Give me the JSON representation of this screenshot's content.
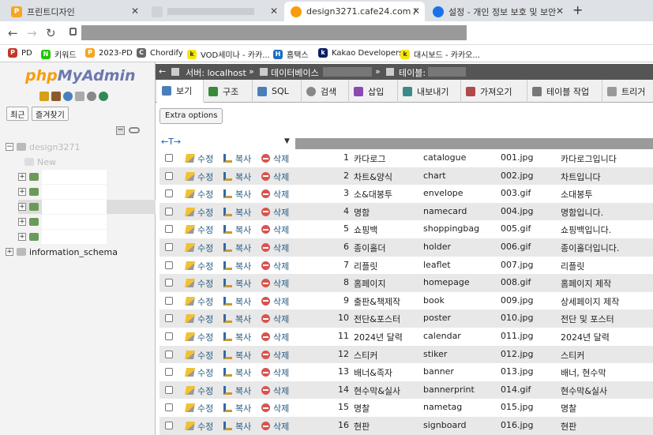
{
  "browser": {
    "tabs": [
      {
        "title": "프린트디자인",
        "icon_color": "#f5a623",
        "icon_letter": "P"
      },
      {
        "title": "",
        "icon_color": "#cfd3d8",
        "icon_letter": ""
      },
      {
        "title": "design3271.cafe24.com / localh",
        "icon_color": "#f89c0e",
        "icon_letter": ""
      },
      {
        "title": "설정 - 개인 정보 보호 및 보안",
        "icon_color": "#1a73e8",
        "icon_letter": ""
      }
    ],
    "new_tab": "+",
    "bookmarks": [
      {
        "label": "PD",
        "color": "#c0392b",
        "letter": "P"
      },
      {
        "label": "키워드",
        "color": "#1ec800",
        "letter": "N"
      },
      {
        "label": "2023-PD",
        "color": "#f5a623",
        "letter": "P"
      },
      {
        "label": "Chordify",
        "color": "#666666",
        "letter": "C"
      },
      {
        "label": "VOD세미나 - 카카...",
        "color": "#f7e600",
        "letter": "k"
      },
      {
        "label": "홈택스",
        "color": "#1a6fc2",
        "letter": "H"
      },
      {
        "label": "Kakao Developers",
        "color": "#0b1f66",
        "letter": "k"
      },
      {
        "label": "대시보드 - 카카오...",
        "color": "#f7e600",
        "letter": "k"
      }
    ]
  },
  "sidebar": {
    "logo_php": "php",
    "logo_my": "MyAdmin",
    "recent_button": "최근",
    "favorites_button": "즐겨찾기",
    "tree": [
      {
        "label": "design3271",
        "type": "db"
      },
      {
        "label": "New",
        "type": "new"
      },
      {
        "label": "",
        "type": "table"
      },
      {
        "label": "",
        "type": "table"
      },
      {
        "label": "",
        "type": "table"
      },
      {
        "label": "",
        "type": "table"
      },
      {
        "label": "",
        "type": "table"
      },
      {
        "label": "information_schema",
        "type": "db"
      }
    ]
  },
  "breadcrumb": {
    "server": "서버: localhost",
    "database": "데이터베이스",
    "table": "테이블:"
  },
  "menu": [
    {
      "label": "보기",
      "color": "#4a7ebb"
    },
    {
      "label": "구조",
      "color": "#3a8a3a"
    },
    {
      "label": "SQL",
      "color": "#4a7ebb"
    },
    {
      "label": "검색",
      "color": "#888888"
    },
    {
      "label": "삽입",
      "color": "#8a4ab0"
    },
    {
      "label": "내보내기",
      "color": "#3a8a8a"
    },
    {
      "label": "가져오기",
      "color": "#b04a4a"
    },
    {
      "label": "테이블 작업",
      "color": "#777777"
    },
    {
      "label": "트리거",
      "color": "#999999"
    }
  ],
  "extra_options": "Extra options",
  "column_arrows": "←T→",
  "actions": {
    "edit": "수정",
    "copy": "복사",
    "delete": "삭제"
  },
  "rows": [
    {
      "id": "1",
      "name": "카다로그",
      "code": "catalogue",
      "file": "001.jpg",
      "desc": "카다로그입니다"
    },
    {
      "id": "2",
      "name": "차트&양식",
      "code": "chart",
      "file": "002.jpg",
      "desc": "차트입니다"
    },
    {
      "id": "3",
      "name": "소&대봉투",
      "code": "envelope",
      "file": "003.gif",
      "desc": "소대봉투"
    },
    {
      "id": "4",
      "name": "명함",
      "code": "namecard",
      "file": "004.jpg",
      "desc": "명함입니다."
    },
    {
      "id": "5",
      "name": "쇼핑백",
      "code": "shoppingbag",
      "file": "005.gif",
      "desc": "쇼핑백입니다."
    },
    {
      "id": "6",
      "name": "종이홀더",
      "code": "holder",
      "file": "006.gif",
      "desc": "종이홀더입니다."
    },
    {
      "id": "7",
      "name": "리플릿",
      "code": "leaflet",
      "file": "007.jpg",
      "desc": "리플릿"
    },
    {
      "id": "8",
      "name": "홈페이지",
      "code": "homepage",
      "file": "008.gif",
      "desc": "홈페이지 제작"
    },
    {
      "id": "9",
      "name": "출판&책제작",
      "code": "book",
      "file": "009.jpg",
      "desc": "상세페이지 제작"
    },
    {
      "id": "10",
      "name": "전단&포스터",
      "code": "poster",
      "file": "010.jpg",
      "desc": "전단 및 포스터"
    },
    {
      "id": "11",
      "name": "2024년 달력",
      "code": "calendar",
      "file": "011.jpg",
      "desc": "2024년 달력"
    },
    {
      "id": "12",
      "name": "스티커",
      "code": "stiker",
      "file": "012.jpg",
      "desc": "스티커"
    },
    {
      "id": "13",
      "name": "배너&족자",
      "code": "banner",
      "file": "013.jpg",
      "desc": "배너, 현수막"
    },
    {
      "id": "14",
      "name": "현수막&실사",
      "code": "bannerprint",
      "file": "014.gif",
      "desc": "현수막&실사"
    },
    {
      "id": "15",
      "name": "명찰",
      "code": "nametag",
      "file": "015.jpg",
      "desc": "명찰"
    },
    {
      "id": "16",
      "name": "현판",
      "code": "signboard",
      "file": "016.jpg",
      "desc": "현판"
    }
  ]
}
